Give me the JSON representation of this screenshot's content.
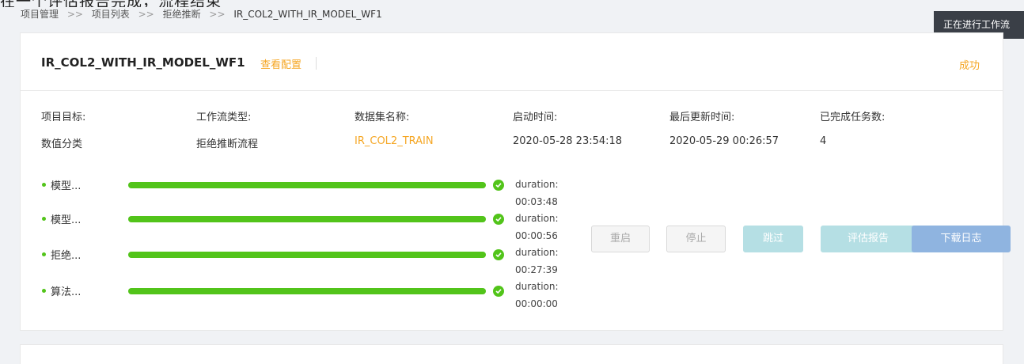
{
  "top_clipped_text": "在一个评估报告完成，流程结束",
  "breadcrumb": {
    "items": [
      "项目管理",
      "项目列表",
      "拒绝推断",
      "IR_COL2_WITH_IR_MODEL_WF1"
    ],
    "separator": ">>"
  },
  "running_tip": "正在进行工作流",
  "workflow": {
    "title": "IR_COL2_WITH_IR_MODEL_WF1",
    "view_config_label": "查看配置",
    "status": "成功"
  },
  "info": {
    "target": {
      "label": "项目目标:",
      "value": "数值分类"
    },
    "workflow_type": {
      "label": "工作流类型:",
      "value": "拒绝推断流程"
    },
    "dataset": {
      "label": "数据集名称:",
      "value": "IR_COL2_TRAIN"
    },
    "start_time": {
      "label": "启动时间:",
      "value": "2020-05-28 23:54:18"
    },
    "last_update": {
      "label": "最后更新时间:",
      "value": "2020-05-29 00:26:57"
    },
    "completed_tasks": {
      "label": "已完成任务数:",
      "value": "4"
    }
  },
  "steps": [
    {
      "name": "模型...",
      "progress": 1.0,
      "status": "success"
    },
    {
      "name": "模型...",
      "progress": 1.0,
      "status": "success"
    },
    {
      "name": "拒绝...",
      "progress": 1.0,
      "status": "success"
    },
    {
      "name": "算法...",
      "progress": 1.0,
      "status": "success"
    }
  ],
  "durations": [
    {
      "label": "duration:",
      "value": "00:03:48"
    },
    {
      "label": "duration:",
      "value": "00:00:56"
    },
    {
      "label": "duration:",
      "value": "00:27:39"
    },
    {
      "label": "duration:",
      "value": "00:00:00"
    }
  ],
  "buttons": {
    "restart": "重启",
    "stop": "停止",
    "skip": "跳过",
    "report": "评估报告",
    "download_log": "下载日志"
  },
  "colors": {
    "accent": "#f5a623",
    "success": "#52c41a",
    "tooltip_bg": "#3a3f47",
    "skip_bg": "#b5dfe4",
    "download_bg": "#8fb4e0"
  }
}
